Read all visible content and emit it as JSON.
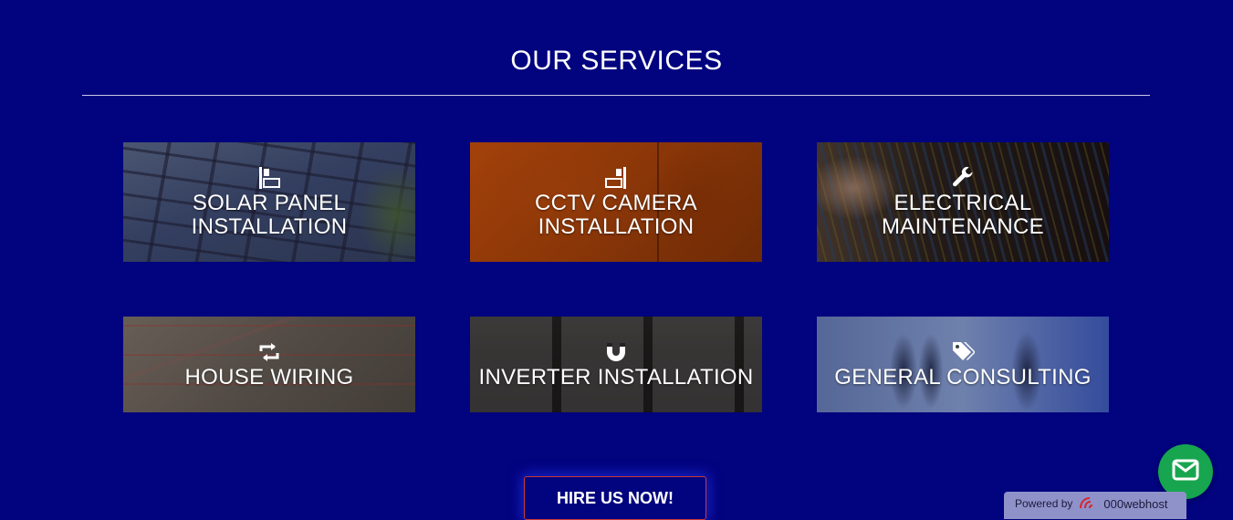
{
  "services": {
    "title": "OUR SERVICES",
    "items": [
      {
        "icon": "solar-panel-icon",
        "label_line1": "SOLAR PANEL",
        "label_line2": "INSTALLATION"
      },
      {
        "icon": "cctv-camera-icon",
        "label_line1": "CCTV CAMERA",
        "label_line2": "INSTALLATION"
      },
      {
        "icon": "wrench-icon",
        "label_line1": "ELECTRICAL",
        "label_line2": "MAINTENANCE"
      },
      {
        "icon": "swap-arrows-icon",
        "label_line1": "HOUSE WIRING"
      },
      {
        "icon": "magnet-icon",
        "label_line1": "INVERTER INSTALLATION"
      },
      {
        "icon": "tags-icon",
        "label_line1": "GENERAL CONSULTING"
      }
    ]
  },
  "cta": {
    "hire_label": "HIRE US NOW!"
  },
  "badge": {
    "powered_by": "Powered by",
    "brand": "000webhost"
  },
  "colors": {
    "background": "#02037e",
    "fab": "#17a54f",
    "cta_border": "#c73a3a"
  }
}
